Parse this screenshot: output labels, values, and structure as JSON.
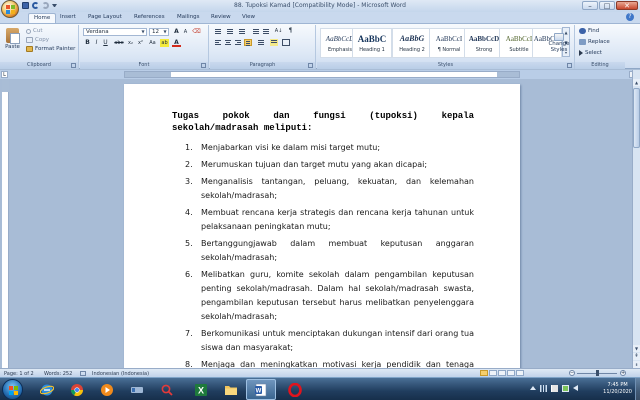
{
  "window": {
    "title": "88. Tupoksi Kamad [Compatibility Mode] - Microsoft Word",
    "controls": {
      "minimize": "–",
      "maximize": "□",
      "close": "✕"
    }
  },
  "tabs": [
    "Home",
    "Insert",
    "Page Layout",
    "References",
    "Mailings",
    "Review",
    "View"
  ],
  "ribbon": {
    "clipboard": {
      "label": "Clipboard",
      "paste": "Paste",
      "cut": "Cut",
      "copy": "Copy",
      "format_painter": "Format Painter"
    },
    "font": {
      "label": "Font",
      "font_name": "Verdana",
      "font_size": "12",
      "bold": "B",
      "italic": "I",
      "underline": "U",
      "strike": "abe",
      "subscript": "x₂",
      "superscript": "x²",
      "change_case": "Aa",
      "grow": "A",
      "shrink": "A",
      "font_color": "A"
    },
    "paragraph": {
      "label": "Paragraph"
    },
    "styles": {
      "label": "Styles",
      "items": [
        {
          "sample": "AaBbCcD",
          "name": "Emphasis"
        },
        {
          "sample": "AaBbC",
          "name": "Heading 1"
        },
        {
          "sample": "AaBbG",
          "name": "Heading 2"
        },
        {
          "sample": "AaBbCcI",
          "name": "¶ Normal"
        },
        {
          "sample": "AaBbCcD",
          "name": "Strong"
        },
        {
          "sample": "AaBbCcI",
          "name": "Subtitle"
        },
        {
          "sample": "AaBbCcI",
          "name": ""
        }
      ],
      "change_styles": "Change Styles"
    },
    "editing": {
      "label": "Editing",
      "find": "Find",
      "replace": "Replace",
      "select": "Select"
    }
  },
  "document": {
    "title": "Tugas pokok dan fungsi (tupoksi) kepala sekolah/madrasah meliputi:",
    "items": [
      {
        "num": "1.",
        "text": "Menjabarkan visi ke dalam misi target mutu;"
      },
      {
        "num": "2.",
        "text": "Merumuskan tujuan dan target mutu yang akan dicapai;"
      },
      {
        "num": "3.",
        "text": "Menganalisis tantangan, peluang, kekuatan, dan kelemahan sekolah/madrasah;"
      },
      {
        "num": "4.",
        "text": "Membuat rencana kerja strategis dan rencana kerja tahunan untuk pelaksanaan peningkatan mutu;"
      },
      {
        "num": "5.",
        "text": "Bertanggungjawab dalam membuat keputusan anggaran sekolah/madrasah;"
      },
      {
        "num": "6.",
        "text": "Melibatkan guru, komite sekolah dalam pengambilan keputusan penting sekolah/madrasah. Dalam hal sekolah/madrasah swasta, pengambilan keputusan tersebut harus melibatkan penyelenggara sekolah/madrasah;"
      },
      {
        "num": "7.",
        "text": "Berkomunikasi untuk menciptakan dukungan intensif dari orang tua siswa dan masyarakat;"
      },
      {
        "num": "8.",
        "text": "Menjaga dan meningkatkan motivasi kerja pendidik dan tenaga kependidikan dengan menggunakan sistem pemberian"
      }
    ]
  },
  "status": {
    "page": "Page: 1 of 2",
    "words": "Words: 252",
    "language": "Indonesian (Indonesia)",
    "zoom_minus": "−",
    "zoom_plus": "+"
  },
  "taskbar": {
    "time": "7:45 PM",
    "date": "11/20/2020"
  },
  "colors": {
    "ribbon_bg": "#dce7f5",
    "doc_bg": "#a8bcd6",
    "taskbar": "#203d5e"
  }
}
